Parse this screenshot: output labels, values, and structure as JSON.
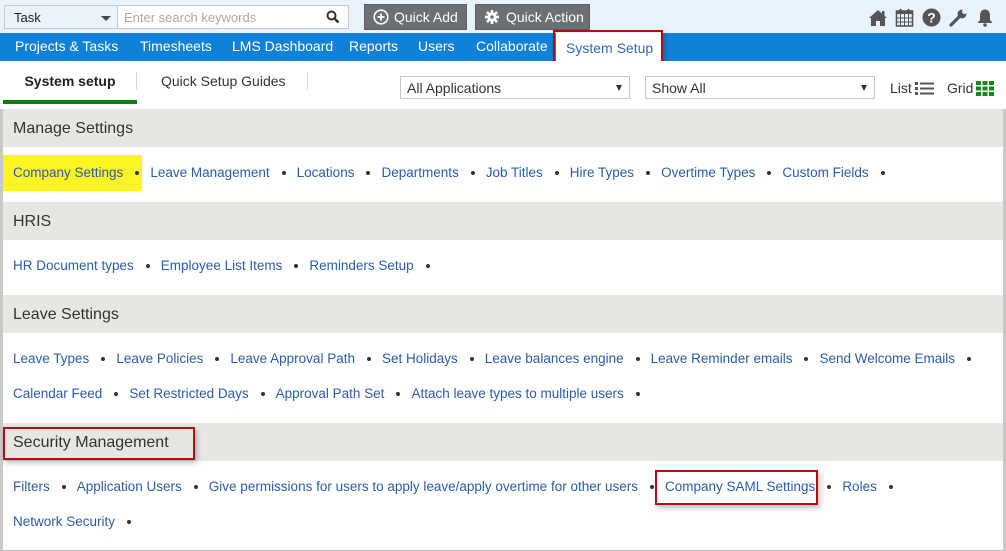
{
  "topbar": {
    "task_select": "Task",
    "search_placeholder": "Enter search keywords",
    "quick_add": "Quick Add",
    "quick_action": "Quick Action",
    "icons": [
      "home-icon",
      "calendar-icon",
      "help-icon",
      "wrench-icon",
      "bell-icon"
    ]
  },
  "nav": {
    "items": [
      "Projects & Tasks",
      "Timesheets",
      "LMS Dashboard",
      "Reports",
      "Users",
      "Collaborate"
    ],
    "active": "System Setup"
  },
  "subtabs": {
    "active": "System setup",
    "guides": "Quick Setup Guides",
    "applications_filter": "All Applications",
    "show_filter": "Show All",
    "list_label": "List",
    "grid_label": "Grid"
  },
  "colors": {
    "nav_blue": "#1181d8",
    "active_tab_underline": "#087f11",
    "highlight_yellow": "#fcf521",
    "annotation_red": "#b00d14",
    "link_blue": "#2a5da9"
  },
  "sections": [
    {
      "title": "Manage Settings",
      "rows": [
        [
          "Company Settings",
          "Leave Management",
          "Locations",
          "Departments",
          "Job Titles",
          "Hire Types",
          "Overtime Types",
          "Custom Fields"
        ]
      ]
    },
    {
      "title": "HRIS",
      "rows": [
        [
          "HR Document types",
          "Employee List Items",
          "Reminders Setup"
        ]
      ]
    },
    {
      "title": "Leave Settings",
      "rows": [
        [
          "Leave Types",
          "Leave Policies",
          "Leave Approval Path",
          "Set Holidays",
          "Leave balances engine",
          "Leave Reminder emails",
          "Send Welcome Emails"
        ],
        [
          "Calendar Feed",
          "Set Restricted Days",
          "Approval Path Set",
          "Attach leave types to multiple users"
        ]
      ]
    },
    {
      "title": "Security Management",
      "rows": [
        [
          "Filters",
          "Application Users",
          "Give permissions for users to apply leave/apply overtime for other users",
          "Company SAML Settings",
          "Roles"
        ],
        [
          "Network Security"
        ]
      ]
    }
  ]
}
